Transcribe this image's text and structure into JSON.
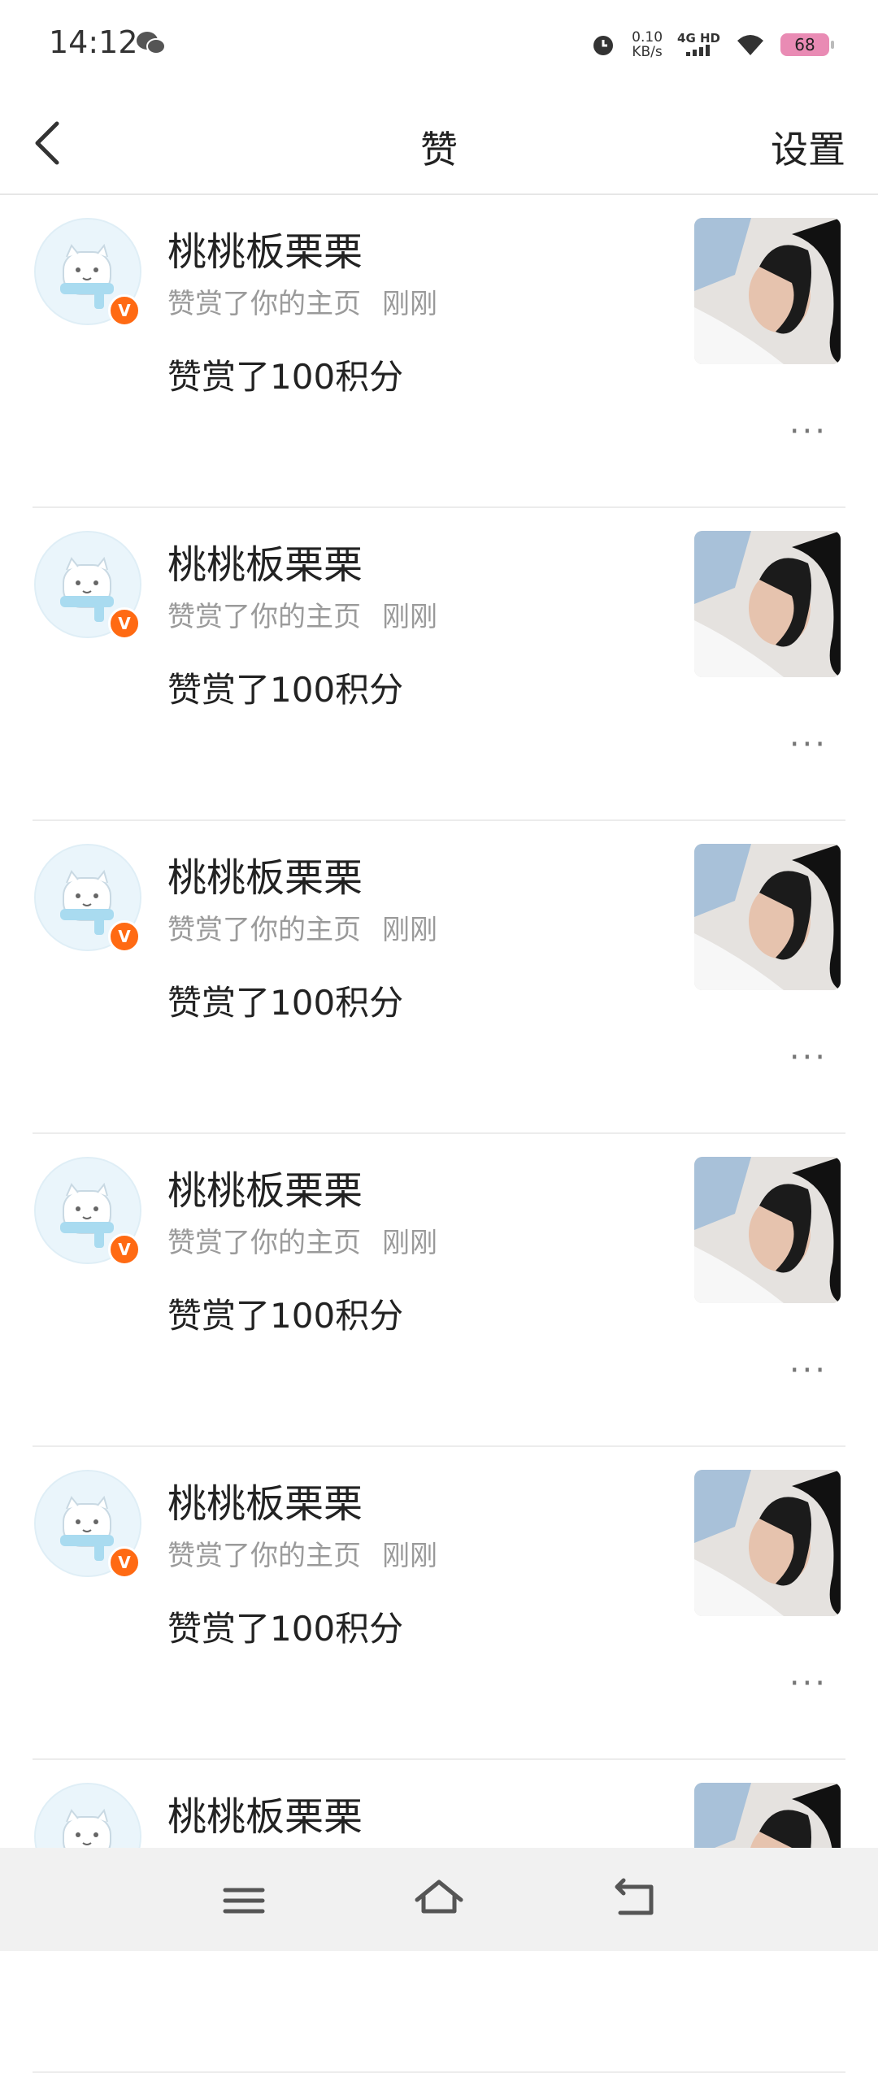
{
  "status": {
    "time": "14:12",
    "speed_value": "0.10",
    "speed_unit": "KB/s",
    "network": "4G HD",
    "battery": "68"
  },
  "header": {
    "title": "赞",
    "settings": "设置"
  },
  "items": [
    {
      "name": "桃桃板栗栗",
      "action": "赞赏了你的主页",
      "time": "刚刚",
      "reward": "赞赏了100积分"
    },
    {
      "name": "桃桃板栗栗",
      "action": "赞赏了你的主页",
      "time": "刚刚",
      "reward": "赞赏了100积分"
    },
    {
      "name": "桃桃板栗栗",
      "action": "赞赏了你的主页",
      "time": "刚刚",
      "reward": "赞赏了100积分"
    },
    {
      "name": "桃桃板栗栗",
      "action": "赞赏了你的主页",
      "time": "刚刚",
      "reward": "赞赏了100积分"
    },
    {
      "name": "桃桃板栗栗",
      "action": "赞赏了你的主页",
      "time": "刚刚",
      "reward": "赞赏了100积分"
    },
    {
      "name": "桃桃板栗栗",
      "action": "",
      "time": "",
      "reward": ""
    }
  ],
  "badge_label": "V",
  "more_label": "···"
}
